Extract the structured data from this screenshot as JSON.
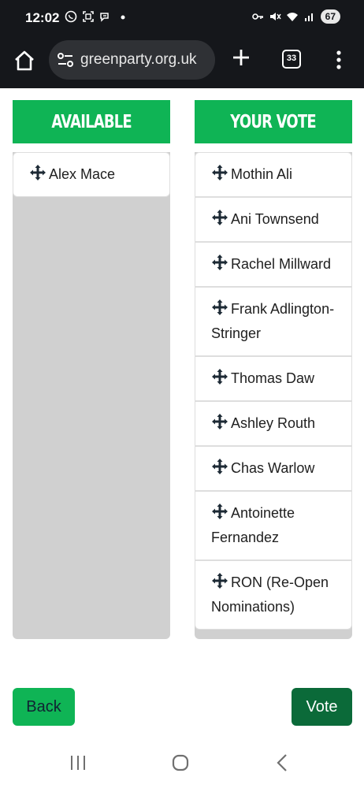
{
  "status_bar": {
    "time": "12:02",
    "battery": "67",
    "icons_left": [
      "whatsapp-icon",
      "screenshot-icon",
      "chat-icon",
      "dot-icon"
    ],
    "icons_right": [
      "key-icon",
      "mute-icon",
      "wifi-icon",
      "signal-icon",
      "battery-icon"
    ]
  },
  "browser": {
    "url": "greenparty.org.uk",
    "tab_count": "33",
    "icons": [
      "home-icon",
      "site-settings-icon",
      "plus-icon",
      "tabs-icon",
      "more-icon"
    ]
  },
  "available": {
    "header": "AVAILABLE",
    "items": [
      "Alex Mace"
    ]
  },
  "your_vote": {
    "header": "YOUR VOTE",
    "items": [
      "Mothin Ali",
      "Ani Townsend",
      "Rachel Millward",
      "Frank Adlington-Stringer",
      "Thomas Daw",
      "Ashley Routh",
      "Chas Warlow",
      "Antoinette Fernandez",
      "RON (Re-Open Nominations)"
    ]
  },
  "buttons": {
    "back": "Back",
    "vote": "Vote"
  },
  "colors": {
    "header_green": "#0fb455",
    "vote_green": "#0b6a39",
    "column_grey": "#d0d0d0",
    "chrome_dark": "#15171b"
  }
}
